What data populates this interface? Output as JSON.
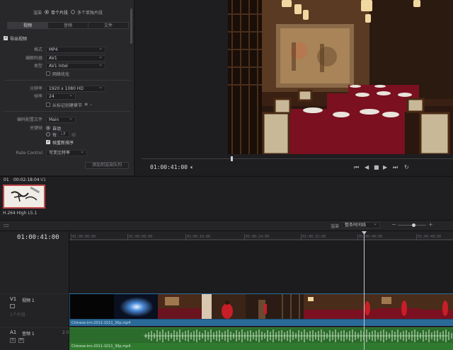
{
  "render_settings": {
    "render_label": "渲染",
    "mode_single": "单个片段",
    "mode_multiple": "多个单独片段",
    "tabs": [
      "视频",
      "音频",
      "文件"
    ],
    "export_video_label": "导出视频",
    "format_label": "格式",
    "format_value": "MP4",
    "codec_label": "编解码器",
    "codec_value": "AV1",
    "type_label": "类型",
    "type_value": "AV1 Intel",
    "network_opt_label": "网络优化",
    "resolution_label": "分辨率",
    "resolution_value": "1920 x 1080 HD",
    "framerate_label": "帧率",
    "framerate_value": "24",
    "chapter_label": "从标记创建章节",
    "profile_label": "编码配置文件",
    "profile_value": "Main",
    "keyframe_label": "关键帧",
    "keyframe_auto": "自动",
    "keyframe_every": "每",
    "keyframe_count": "12",
    "keyframe_frames": "帧",
    "frame_reorder_label": "帧重新排序",
    "rate_control_label": "Rate Control",
    "rate_control_value": "可变比特率",
    "add_queue_button": "添加到渲染队列"
  },
  "viewer": {
    "timecode": "01:00:41:00",
    "transport": [
      "⏮",
      "◀",
      "■",
      "▶",
      "⏭",
      "↻"
    ],
    "volume_icon": "speaker-icon"
  },
  "bin": {
    "clip_index": "01",
    "clip_timecode": "00:02:18:04",
    "clip_track": "V1",
    "clip_codec": "H.264 High L5.1"
  },
  "timeline": {
    "render_label": "渲染",
    "render_mode": "整条时间线",
    "timecode": "01:00:41:00",
    "ruler": [
      "01:00:00:00",
      "01:00:08:00",
      "01:00:16:00",
      "01:00:24:00",
      "01:00:32:00",
      "01:00:40:00",
      "01:00:48:00"
    ],
    "v1": {
      "id": "V1",
      "name": "视频 1",
      "info": "1个片段"
    },
    "a1": {
      "id": "A1",
      "name": "音频 1",
      "ch": "2.0",
      "solo": "S",
      "mute": "M"
    },
    "v1_clip": "Chinese-inn-2011-1011_30p.mp4",
    "a1_clip": "Chinese-inn-2011-1011_30p.mp4"
  },
  "colors": {
    "accent": "#c2494a",
    "video_clip": "#1d4f73",
    "audio_clip": "#2b6b2b",
    "tablecloth": "#7b1020"
  }
}
